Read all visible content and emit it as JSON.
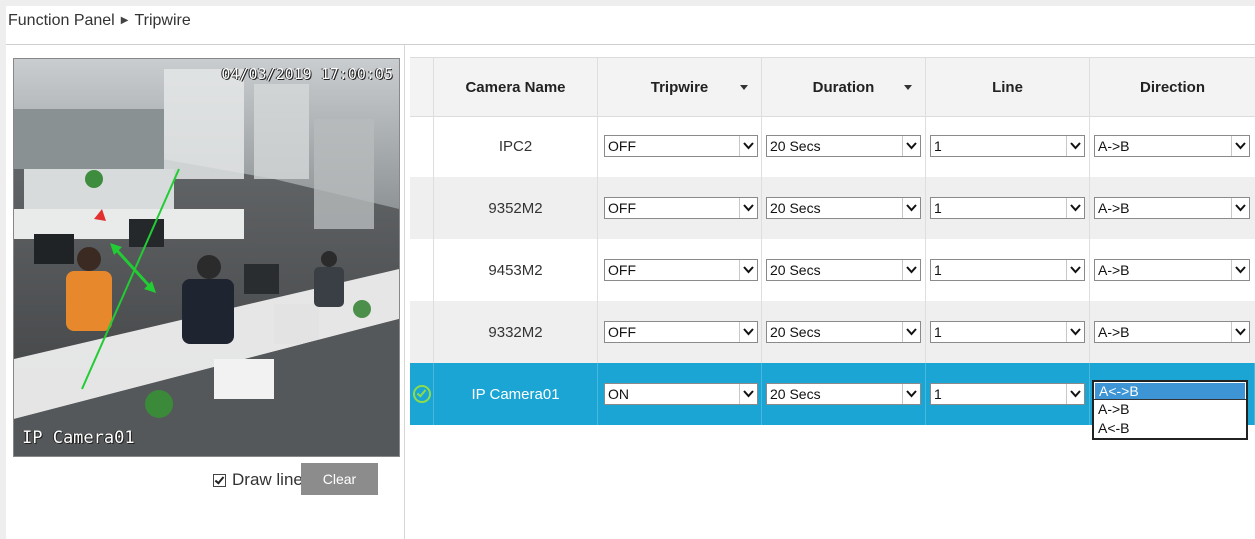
{
  "breadcrumb": {
    "root": "Function Panel",
    "separator": "▶",
    "current": "Tripwire"
  },
  "preview": {
    "timestamp": "04/03/2019 17:00:05",
    "camera_label": "IP Camera01"
  },
  "draw_line": {
    "label": "Draw line",
    "checked": true
  },
  "clear_button": "Clear",
  "table": {
    "headers": {
      "camera_name": "Camera Name",
      "tripwire": "Tripwire",
      "duration": "Duration",
      "line": "Line",
      "direction": "Direction"
    },
    "rows": [
      {
        "camera_name": "IPC2",
        "tripwire": "OFF",
        "duration": "20 Secs",
        "line": "1",
        "direction": "A->B",
        "selected": false
      },
      {
        "camera_name": "9352M2",
        "tripwire": "OFF",
        "duration": "20 Secs",
        "line": "1",
        "direction": "A->B",
        "selected": false
      },
      {
        "camera_name": "9453M2",
        "tripwire": "OFF",
        "duration": "20 Secs",
        "line": "1",
        "direction": "A->B",
        "selected": false
      },
      {
        "camera_name": "9332M2",
        "tripwire": "OFF",
        "duration": "20 Secs",
        "line": "1",
        "direction": "A->B",
        "selected": false
      },
      {
        "camera_name": "IP Camera01",
        "tripwire": "ON",
        "duration": "20 Secs",
        "line": "1",
        "direction": "A<->B",
        "selected": true
      }
    ]
  },
  "direction_dropdown": {
    "options": [
      "A<->B",
      "A->B",
      "A<-B"
    ],
    "highlighted": "A<->B"
  },
  "colors": {
    "selected_row": "#1aa5d4",
    "selected_option": "#3d95d6",
    "check_icon": "#8ddc4a",
    "tripwire_line": "#22cc33",
    "arrow_color": "#22cc33"
  }
}
